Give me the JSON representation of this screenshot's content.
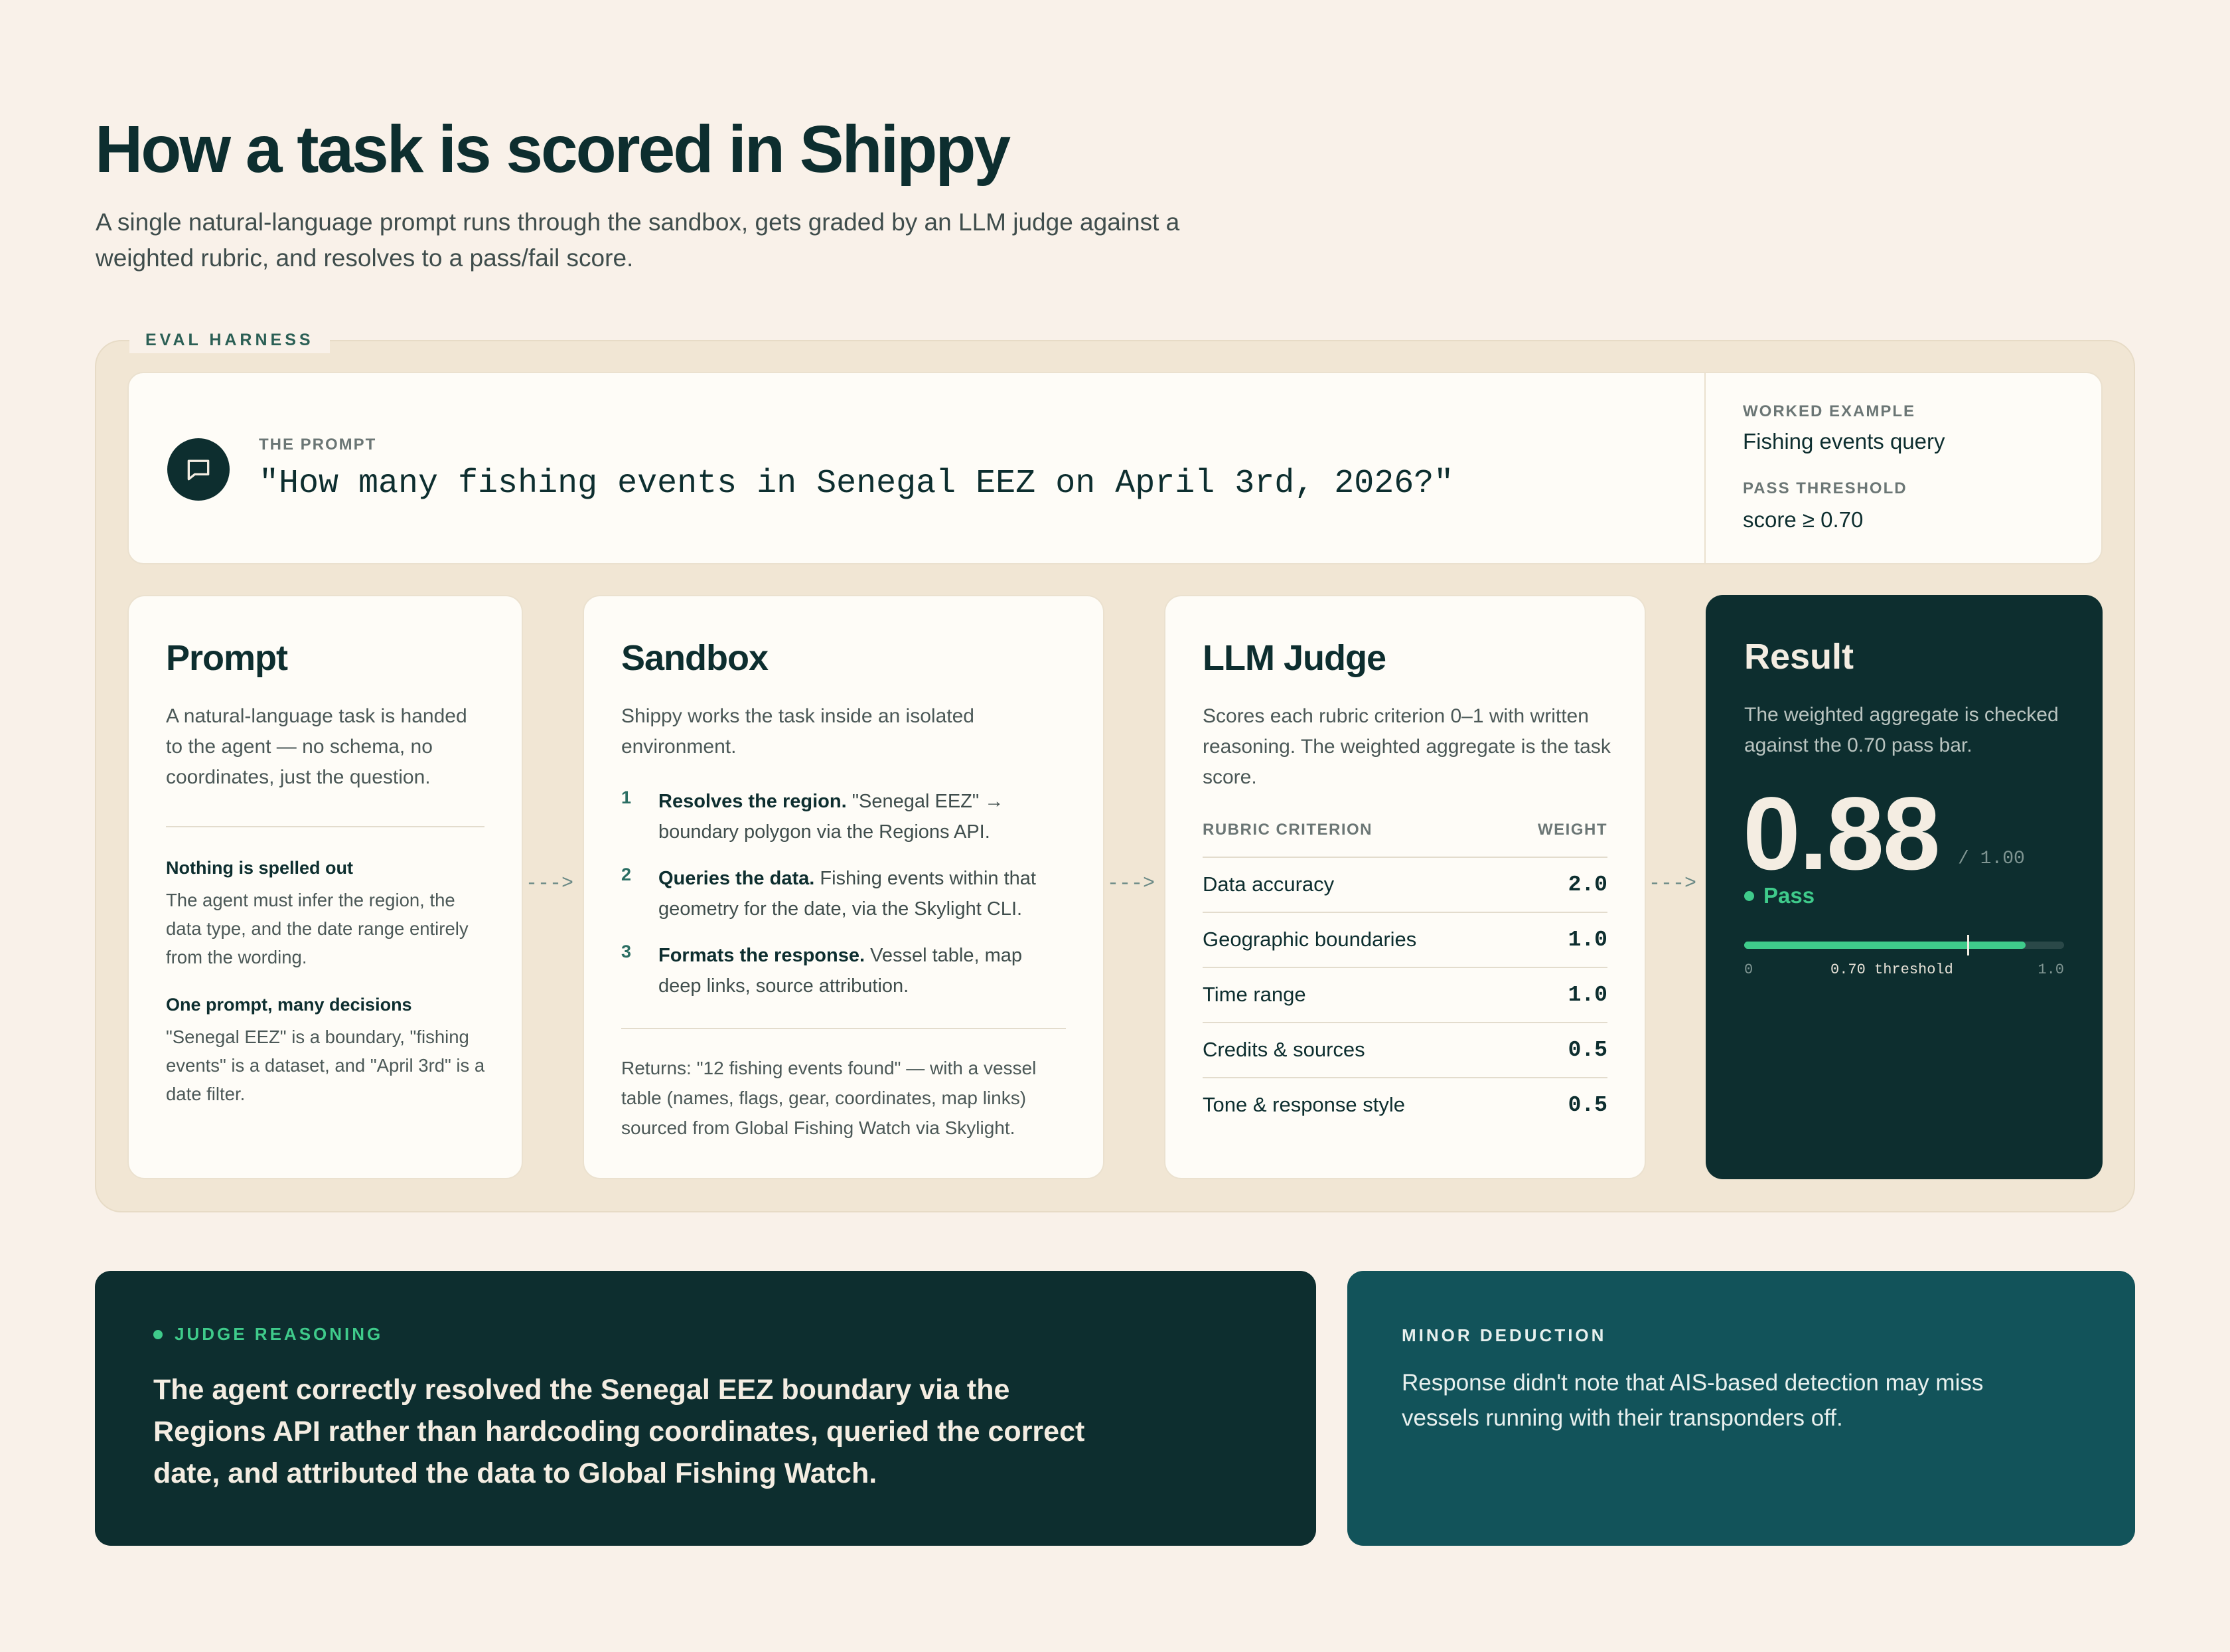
{
  "page": {
    "title": "How a task is scored in Shippy",
    "subtitle": "A single natural-language prompt runs through the sandbox, gets graded by an LLM judge against a weighted rubric, and resolves to a pass/fail score."
  },
  "harness": {
    "tag": "EVAL HARNESS",
    "prompt_label": "THE PROMPT",
    "prompt_text": "\"How many fishing events in Senegal EEZ on April 3rd, 2026?\"",
    "worked_example_label": "WORKED EXAMPLE",
    "worked_example_value": "Fishing events query",
    "pass_threshold_label": "PASS THRESHOLD",
    "pass_threshold_value": "score ≥ 0.70"
  },
  "stages": {
    "prompt": {
      "title": "Prompt",
      "desc": "A natural-language task is handed to the agent — no schema, no coordinates, just the question.",
      "note1_title": "Nothing is spelled out",
      "note1_body": "The agent must infer the region, the data type, and the date range entirely from the wording.",
      "note2_title": "One prompt, many decisions",
      "note2_body": "\"Senegal EEZ\" is a boundary, \"fishing events\" is a dataset, and \"April 3rd\" is a date filter."
    },
    "sandbox": {
      "title": "Sandbox",
      "desc": "Shippy works the task inside an isolated environment.",
      "steps": [
        {
          "num": "1",
          "bold": "Resolves the region.",
          "text": " \"Senegal EEZ\" → boundary polygon via the Regions API."
        },
        {
          "num": "2",
          "bold": "Queries the data.",
          "text": " Fishing events within that geometry for the date, via the Skylight CLI."
        },
        {
          "num": "3",
          "bold": "Formats the response.",
          "text": " Vessel table, map deep links, source attribution."
        }
      ],
      "returns": "Returns: \"12 fishing events found\" — with a vessel table (names, flags, gear, coordinates, map links) sourced from Global Fishing Watch via Skylight."
    },
    "judge": {
      "title": "LLM Judge",
      "desc": "Scores each rubric criterion 0–1 with written reasoning. The weighted aggregate is the task score.",
      "col_criterion": "RUBRIC CRITERION",
      "col_weight": "WEIGHT",
      "rubric": [
        {
          "criterion": "Data accuracy",
          "weight": "2.0"
        },
        {
          "criterion": "Geographic boundaries",
          "weight": "1.0"
        },
        {
          "criterion": "Time range",
          "weight": "1.0"
        },
        {
          "criterion": "Credits & sources",
          "weight": "0.5"
        },
        {
          "criterion": "Tone & response style",
          "weight": "0.5"
        }
      ]
    },
    "result": {
      "title": "Result",
      "desc": "The weighted aggregate is checked against the 0.70 pass bar.",
      "score": "0.88",
      "score_max": "/ 1.00",
      "status": "Pass",
      "score_value": 0.88,
      "threshold_value": 0.7,
      "axis_min": "0",
      "axis_threshold": "0.70 threshold",
      "axis_max": "1.0"
    }
  },
  "connector": "--->",
  "reasoning": {
    "label": "JUDGE REASONING",
    "text": "The agent correctly resolved the Senegal EEZ boundary via the Regions API rather than hardcoding coordinates, queried the correct date, and attributed the data to Global Fishing Watch."
  },
  "deduction": {
    "label": "MINOR DEDUCTION",
    "text": "Response didn't note that AIS-based detection may miss vessels running with their transponders off."
  },
  "colors": {
    "background": "#f9f1e9",
    "ink": "#0d2e2f",
    "accent_green": "#3fcb8b",
    "teal_panel": "#12535a"
  }
}
